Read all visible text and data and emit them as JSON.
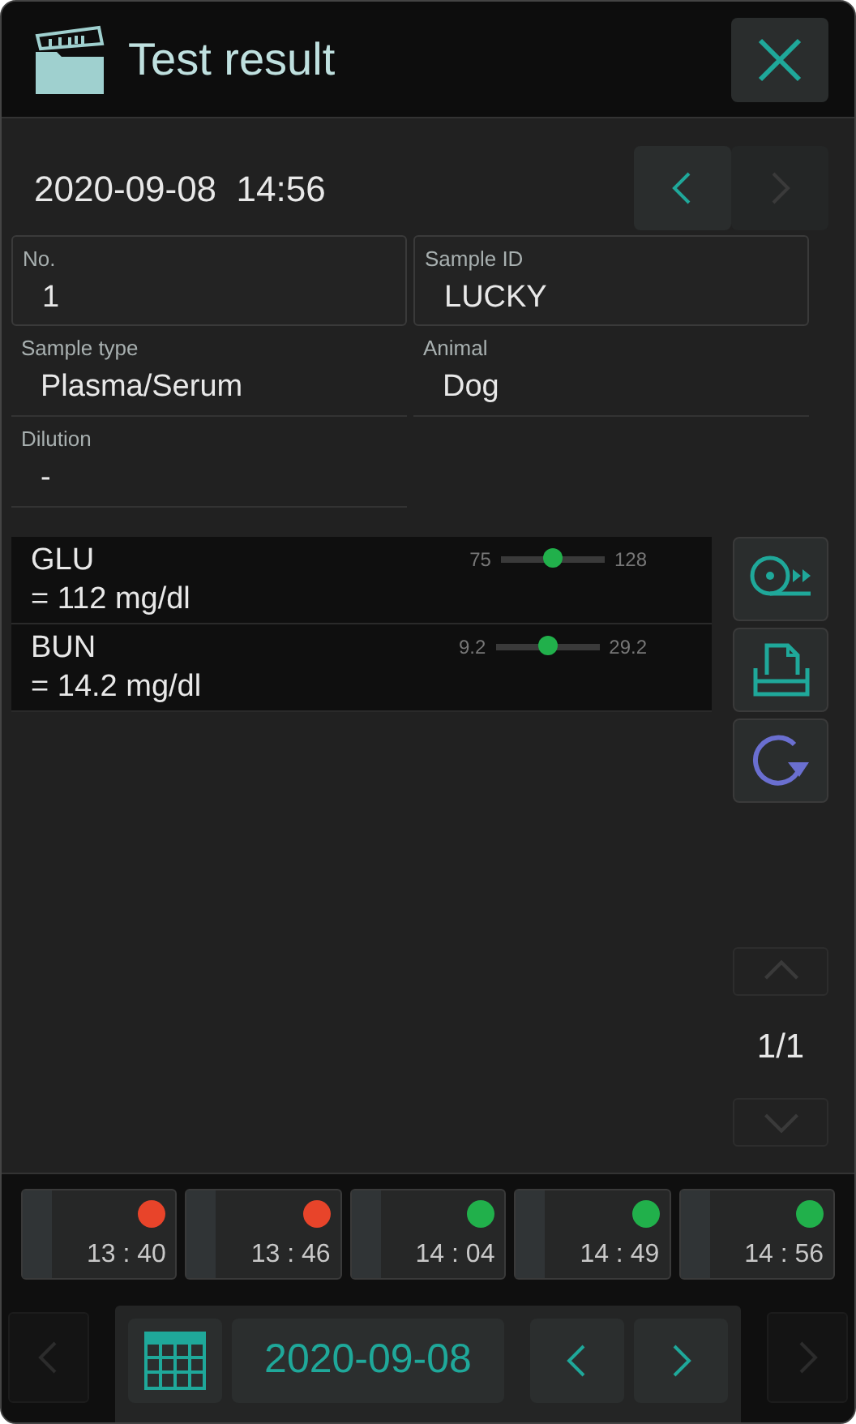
{
  "window": {
    "title": "Test result"
  },
  "record": {
    "datetime": "2020-09-08  14:56",
    "prev_disabled": false,
    "next_disabled": true
  },
  "fields": [
    {
      "label": "No.",
      "value": "1",
      "boxed": true
    },
    {
      "label": "Sample ID",
      "value": "LUCKY",
      "boxed": true
    },
    {
      "label": "Sample type",
      "value": "Plasma/Serum",
      "boxed": false
    },
    {
      "label": "Animal",
      "value": "Dog",
      "boxed": false
    },
    {
      "label": "Dilution",
      "value": "-",
      "boxed": false
    }
  ],
  "results": [
    {
      "name": "GLU",
      "value": "= 112 mg/dl",
      "low": "75",
      "high": "128",
      "level": 0.5
    },
    {
      "name": "BUN",
      "value": "= 14.2 mg/dl",
      "low": "9.2",
      "high": "29.2",
      "level": 0.5
    }
  ],
  "actions": [
    {
      "kind": "export"
    },
    {
      "kind": "print"
    },
    {
      "kind": "retest"
    }
  ],
  "pager": {
    "text": "1/1",
    "up_disabled": true,
    "down_disabled": true
  },
  "history": [
    {
      "time": "13 : 40",
      "color": "#e8442a"
    },
    {
      "time": "13 : 46",
      "color": "#e8442a"
    },
    {
      "time": "14 : 04",
      "color": "#21b04b"
    },
    {
      "time": "14 : 49",
      "color": "#21b04b"
    },
    {
      "time": "14 : 56",
      "color": "#21b04b"
    }
  ],
  "footer": {
    "date": "2020-09-08",
    "page_prev_disabled": true,
    "page_next_disabled": true
  }
}
